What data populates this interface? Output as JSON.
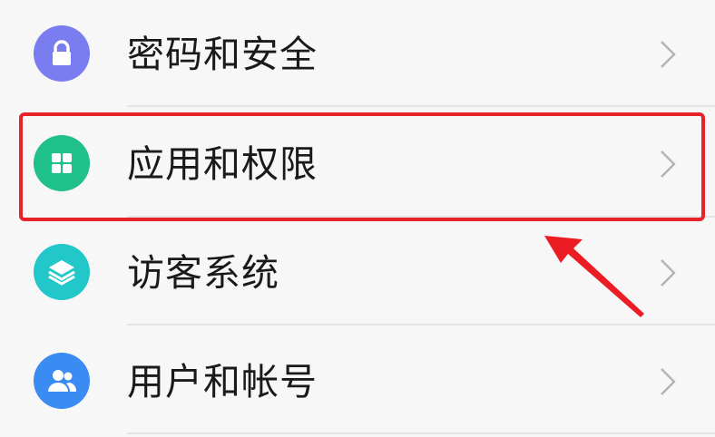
{
  "settings_list": {
    "items": [
      {
        "label": "密码和安全",
        "icon": "lock-icon",
        "icon_color": "#7a7df0"
      },
      {
        "label": "应用和权限",
        "icon": "app-grid-icon",
        "icon_color": "#1fc08a"
      },
      {
        "label": "访客系统",
        "icon": "layers-icon",
        "icon_color": "#22c7c9"
      },
      {
        "label": "用户和帐号",
        "icon": "users-icon",
        "icon_color": "#3a8cf2"
      }
    ]
  },
  "annotation": {
    "highlight_color": "#e8212b",
    "highlighted_item": "应用和权限"
  }
}
